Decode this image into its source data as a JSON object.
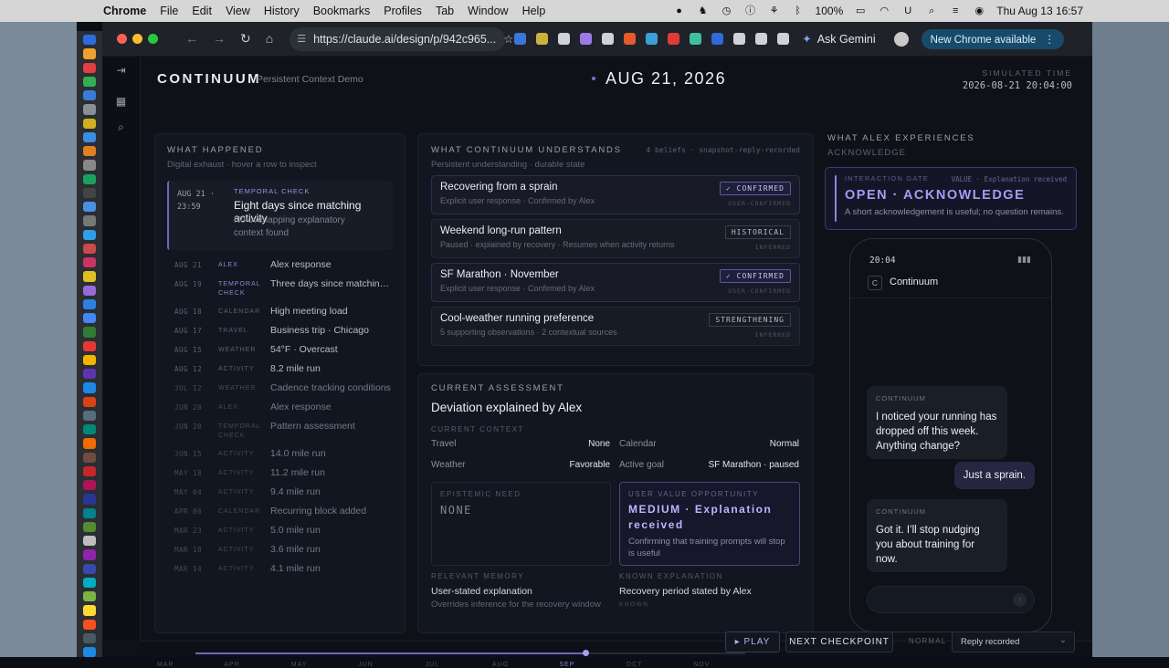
{
  "menubar": {
    "app": "Chrome",
    "items": [
      "File",
      "Edit",
      "View",
      "History",
      "Bookmarks",
      "Profiles",
      "Tab",
      "Window",
      "Help"
    ],
    "battery": "100%",
    "datetime": "Thu Aug 13  16:57"
  },
  "browser": {
    "url": "https://claude.ai/design/p/942c965...",
    "ask_gemini": "Ask Gemini",
    "new_chrome": "New Chrome available"
  },
  "header": {
    "brand": "CONTINUUM",
    "subtitle": "Persistent Context Demo",
    "date": "AUG 21, 2026",
    "sim_label": "SIMULATED TIME",
    "sim_value": "2026-08-21 20:04:00"
  },
  "what_happened": {
    "title": "WHAT HAPPENED",
    "subtitle": "Digital exhaust · hover a row to inspect",
    "highlight": {
      "date": "AUG 21 · 23:59",
      "category": "TEMPORAL CHECK",
      "title": "Eight days since matching activity",
      "sub": "No overlapping explanatory context found"
    },
    "rows": [
      {
        "date": "AUG 21",
        "cat": "ALEX",
        "label": "Alex response",
        "kind": "alex",
        "old": false
      },
      {
        "date": "AUG 19",
        "cat": "TEMPORAL CHECK",
        "label": "Three days since matching activity",
        "kind": "tc",
        "old": false
      },
      {
        "date": "AUG 18",
        "cat": "CALENDAR",
        "label": "High meeting load",
        "kind": "",
        "old": false
      },
      {
        "date": "AUG 17",
        "cat": "TRAVEL",
        "label": "Business trip · Chicago",
        "kind": "",
        "old": false
      },
      {
        "date": "AUG 15",
        "cat": "WEATHER",
        "label": "54°F · Overcast",
        "kind": "",
        "old": false
      },
      {
        "date": "AUG 12",
        "cat": "ACTIVITY",
        "label": "8.2 mile run",
        "kind": "",
        "old": false
      },
      {
        "date": "JUL 12",
        "cat": "WEATHER",
        "label": "Cadence tracking conditions",
        "kind": "",
        "old": true
      },
      {
        "date": "JUN 20",
        "cat": "ALEX",
        "label": "Alex response",
        "kind": "alex",
        "old": true
      },
      {
        "date": "JUN 20",
        "cat": "TEMPORAL CHECK",
        "label": "Pattern assessment",
        "kind": "tc",
        "old": true
      },
      {
        "date": "JUN 15",
        "cat": "ACTIVITY",
        "label": "14.0 mile run",
        "kind": "",
        "old": true
      },
      {
        "date": "MAY 18",
        "cat": "ACTIVITY",
        "label": "11.2 mile run",
        "kind": "",
        "old": true
      },
      {
        "date": "MAY 04",
        "cat": "ACTIVITY",
        "label": "9.4 mile run",
        "kind": "",
        "old": true
      },
      {
        "date": "APR 06",
        "cat": "CALENDAR",
        "label": "Recurring block added",
        "kind": "",
        "old": true
      },
      {
        "date": "MAR 23",
        "cat": "ACTIVITY",
        "label": "5.0 mile run",
        "kind": "",
        "old": true
      },
      {
        "date": "MAR 18",
        "cat": "ACTIVITY",
        "label": "3.6 mile run",
        "kind": "",
        "old": true
      },
      {
        "date": "MAR 14",
        "cat": "ACTIVITY",
        "label": "4.1 mile run",
        "kind": "",
        "old": true
      }
    ]
  },
  "understands": {
    "title": "WHAT CONTINUUM UNDERSTANDS",
    "subtitle": "Persistent understanding · durable state",
    "meta": "4 beliefs · snapshot-reply-recorded",
    "beliefs": [
      {
        "title": "Recovering from a sprain",
        "sub": "Explicit user response · Confirmed by Alex",
        "tag": "✓ CONFIRMED",
        "src": "USER-CONFIRMED",
        "confirmed": true
      },
      {
        "title": "Weekend long-run pattern",
        "sub": "Paused · explained by recovery · Resumes when activity returns",
        "tag": "HISTORICAL",
        "src": "INFERRED",
        "confirmed": false
      },
      {
        "title": "SF Marathon · November",
        "sub": "Explicit user response · Confirmed by Alex",
        "tag": "✓ CONFIRMED",
        "src": "USER-CONFIRMED",
        "confirmed": true
      },
      {
        "title": "Cool-weather running preference",
        "sub": "5 supporting observations · 2 contextual sources",
        "tag": "STRENGTHENING",
        "src": "INFERRED",
        "confirmed": false
      }
    ]
  },
  "assessment": {
    "title": "CURRENT ASSESSMENT",
    "headline": "Deviation explained by Alex",
    "context_label": "CURRENT CONTEXT",
    "travel_k": "Travel",
    "travel_v": "None",
    "calendar_k": "Calendar",
    "calendar_v": "Normal",
    "weather_k": "Weather",
    "weather_v": "Favorable",
    "goal_k": "Active goal",
    "goal_v": "SF Marathon · paused",
    "epistemic_label": "EPISTEMIC NEED",
    "epistemic_value": "NONE",
    "value_label": "USER VALUE OPPORTUNITY",
    "value_value": "MEDIUM · Explanation received",
    "value_desc": "Confirming that training prompts will stop is useful",
    "memory_label": "RELEVANT MEMORY",
    "memory_value": "User-stated explanation",
    "memory_sub": "Overrides inference for the recovery window",
    "known_label": "KNOWN EXPLANATION",
    "known_value": "Recovery period stated by Alex",
    "known_sub": "KNOWN"
  },
  "experience": {
    "title": "WHAT ALEX EXPERIENCES",
    "subtitle": "ACKNOWLEDGE",
    "gate_label": "INTERACTION GATE",
    "gate_value_tag": "VALUE · Explanation received",
    "gate_state": "OPEN · ACKNOWLEDGE",
    "gate_desc": "A short acknowledgement is useful; no question remains.",
    "phone_time": "20:04",
    "phone_app": "Continuum",
    "phone_app_initial": "C",
    "messages": [
      {
        "from": "CONTINUUM",
        "text": "I noticed your running has dropped off this week. Anything change?"
      },
      {
        "from": "",
        "text": "Just a sprain."
      },
      {
        "from": "CONTINUUM",
        "text": "Got it. I’ll stop nudging you about training for now."
      }
    ]
  },
  "timeline": {
    "months": [
      "MAR",
      "APR",
      "MAY",
      "JUN",
      "JUL",
      "AUG",
      "SEP",
      "OCT",
      "NOV"
    ],
    "progress": 0.71,
    "play": "▸ PLAY",
    "next": "NEXT CHECKPOINT",
    "speed": "NORMAL",
    "snapshot": "Reply recorded"
  },
  "colors": {
    "accent": "#8d83e0",
    "confirmed": "#c8c4f5"
  }
}
